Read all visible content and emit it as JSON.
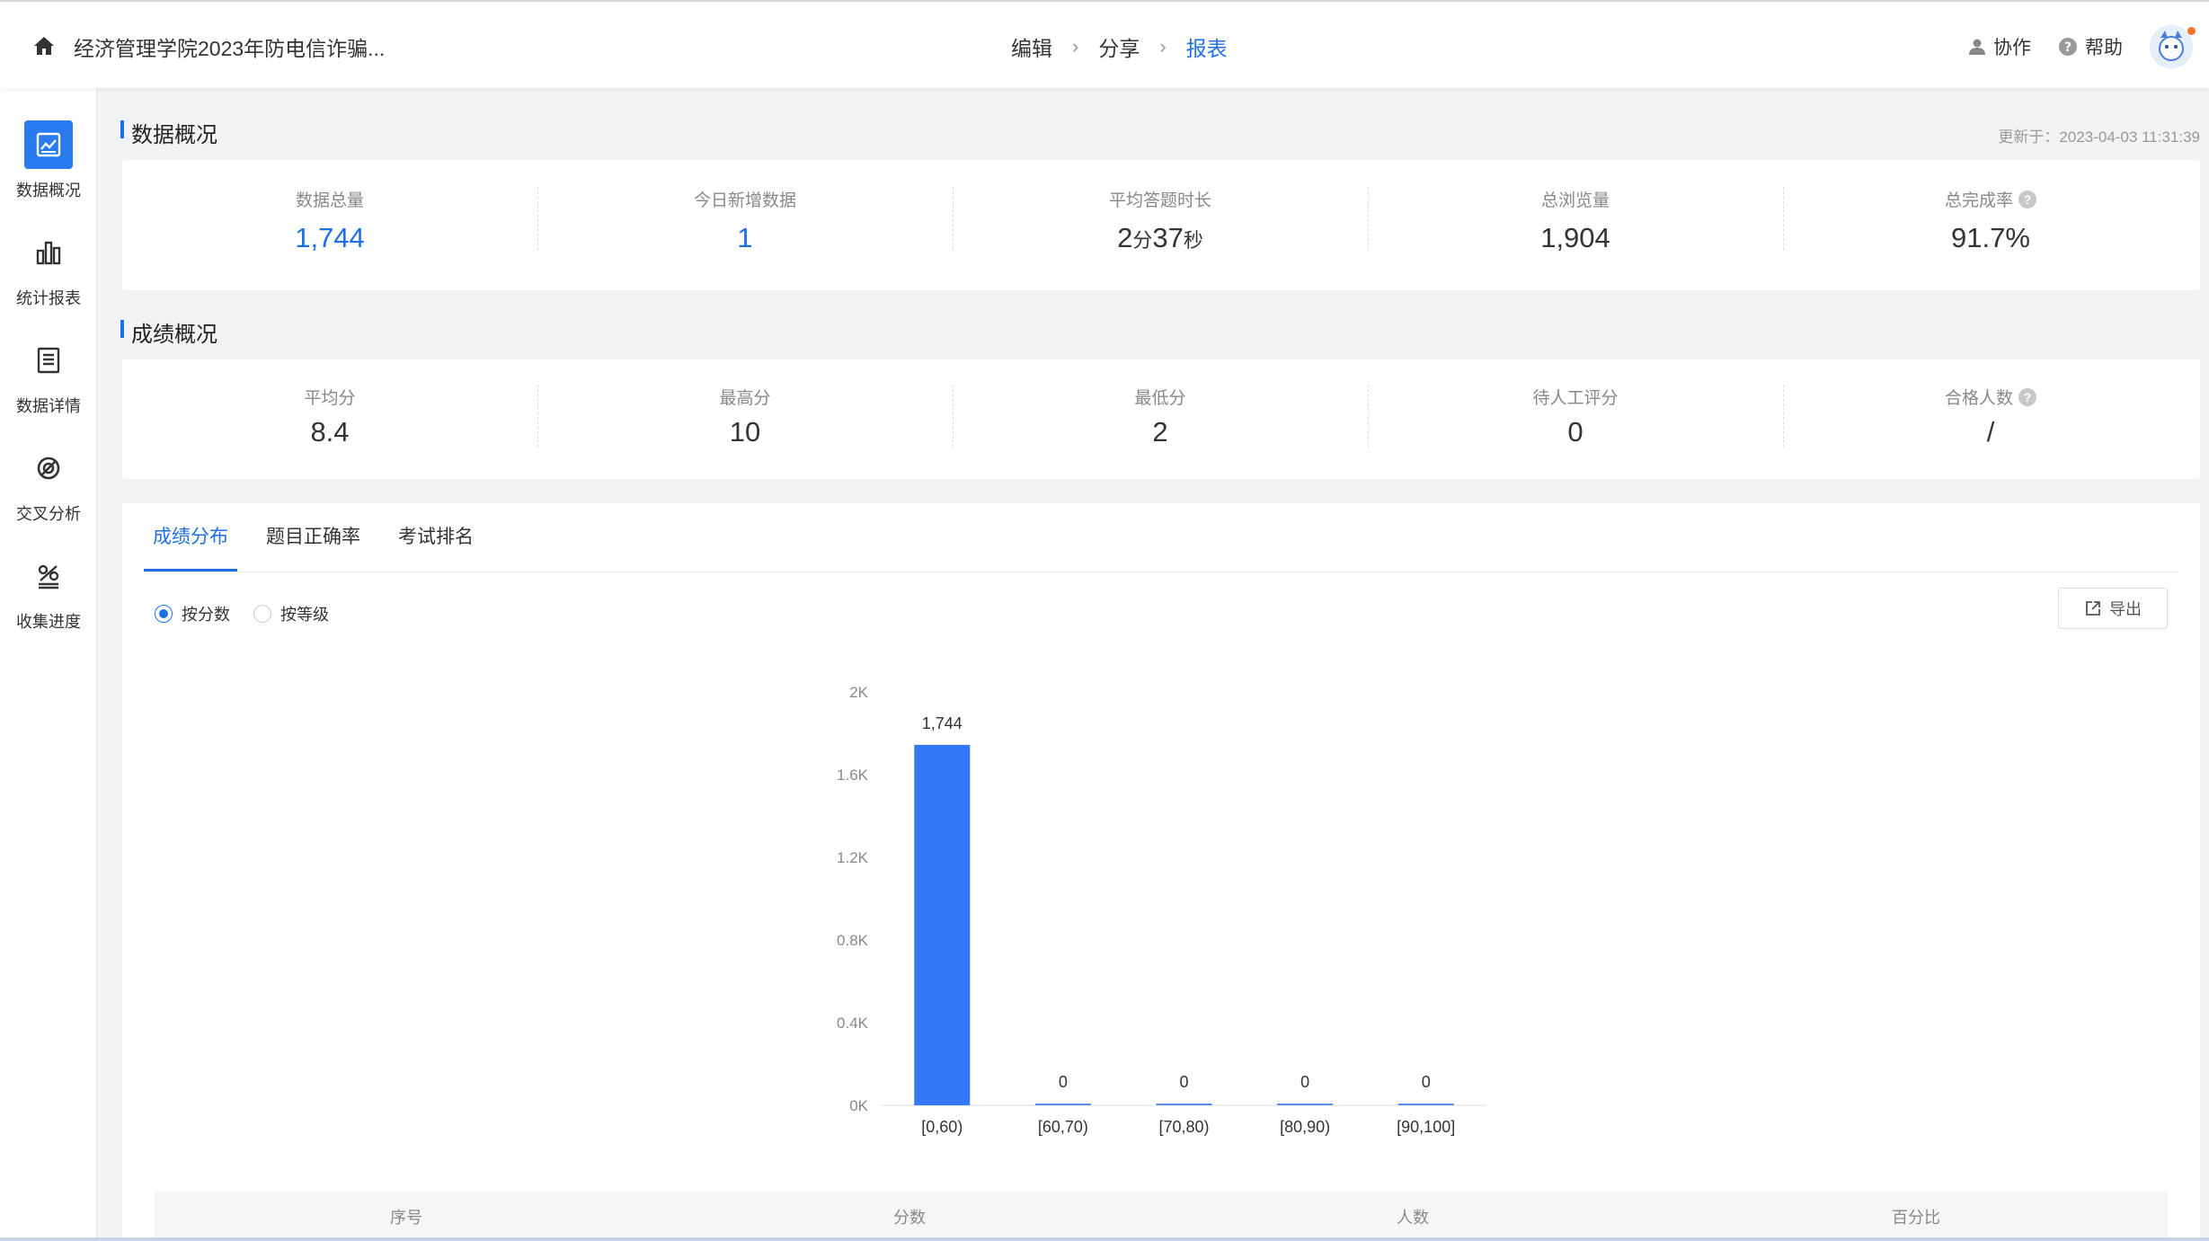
{
  "header": {
    "title": "经济管理学院2023年防电信诈骗...",
    "steps": [
      {
        "label": "编辑",
        "active": false
      },
      {
        "label": "分享",
        "active": false
      },
      {
        "label": "报表",
        "active": true
      }
    ],
    "collab_label": "协作",
    "help_label": "帮助"
  },
  "sidebar": {
    "items": [
      {
        "label": "数据概况",
        "icon": "chart-line-icon",
        "active": true
      },
      {
        "label": "统计报表",
        "icon": "bar-chart-icon",
        "active": false
      },
      {
        "label": "数据详情",
        "icon": "document-icon",
        "active": false
      },
      {
        "label": "交叉分析",
        "icon": "cross-circle-icon",
        "active": false
      },
      {
        "label": "收集进度",
        "icon": "progress-icon",
        "active": false
      }
    ]
  },
  "overview": {
    "title": "数据概况",
    "updated": "更新于：2023-04-03 11:31:39",
    "stats": [
      {
        "label": "数据总量",
        "value": "1,744"
      },
      {
        "label": "今日新增数据",
        "value": "1"
      },
      {
        "label": "平均答题时长",
        "min": "2",
        "min_unit": "分",
        "sec": "37",
        "sec_unit": "秒"
      },
      {
        "label": "总浏览量",
        "value": "1,904"
      },
      {
        "label": "总完成率",
        "value": "91.7%"
      }
    ]
  },
  "scores": {
    "title": "成绩概况",
    "stats": [
      {
        "label": "平均分",
        "value": "8.4"
      },
      {
        "label": "最高分",
        "value": "10"
      },
      {
        "label": "最低分",
        "value": "2"
      },
      {
        "label": "待人工评分",
        "value": "0"
      },
      {
        "label": "合格人数",
        "value": "/"
      }
    ]
  },
  "panel": {
    "tabs": [
      {
        "label": "成绩分布",
        "active": true
      },
      {
        "label": "题目正确率",
        "active": false
      },
      {
        "label": "考试排名",
        "active": false
      }
    ],
    "radios": [
      {
        "label": "按分数",
        "checked": true
      },
      {
        "label": "按等级",
        "checked": false
      }
    ],
    "export_label": "导出",
    "table_headers": [
      "序号",
      "分数",
      "人数",
      "百分比"
    ]
  },
  "colors": {
    "accent": "#1f6fe5",
    "bar": "#3478f6"
  },
  "chart_data": {
    "type": "bar",
    "categories": [
      "[0,60)",
      "[60,70)",
      "[70,80)",
      "[80,90)",
      "[90,100]"
    ],
    "values": [
      1744,
      0,
      0,
      0,
      0
    ],
    "data_labels": [
      "1,744",
      "0",
      "0",
      "0",
      "0"
    ],
    "ylim": [
      0,
      2000
    ],
    "yticks": [
      0,
      400,
      800,
      1200,
      1600,
      2000
    ],
    "ytick_labels": [
      "0K",
      "0.4K",
      "0.8K",
      "1.2K",
      "1.6K",
      "2K"
    ],
    "grid": false
  }
}
